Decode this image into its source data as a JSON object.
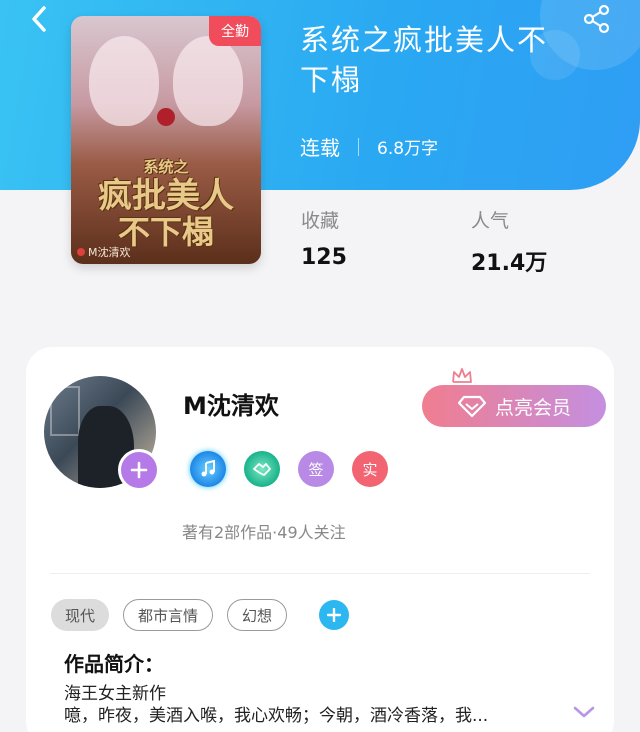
{
  "book": {
    "title": "系统之疯批美人不下榻",
    "status": "连载",
    "word_count": "6.8万字",
    "cover": {
      "badge": "全勤",
      "art_title_top": "系统之",
      "art_title_mid": "疯批美人",
      "art_title_bottom": "不下榻",
      "author_mark": "M沈清欢"
    },
    "stats": {
      "favorites_label": "收藏",
      "favorites_value": "125",
      "popularity_label": "人气",
      "popularity_value": "21.4万"
    }
  },
  "author": {
    "name": "M沈清欢",
    "vip_button": "点亮会员",
    "stats_line": "著有2部作品·49人关注",
    "badges": [
      {
        "icon": "music-note-icon"
      },
      {
        "icon": "handshake-icon"
      },
      {
        "label": "签"
      },
      {
        "label": "实"
      }
    ]
  },
  "tags": [
    "现代",
    "都市言情",
    "幻想"
  ],
  "intro": {
    "title": "作品简介：",
    "line1": "海王女主新作",
    "line2": "噫，昨夜，美酒入喉，我心欢畅；今朝，酒冷香落，我..."
  },
  "colors": {
    "header": "#2aa8f2",
    "accent_blue": "#2cb7f0",
    "badge_red": "#f04c5b",
    "vip_gradient_start": "#f07d8f",
    "vip_gradient_end": "#c48fe0",
    "follow_purple": "#b67ae8"
  }
}
